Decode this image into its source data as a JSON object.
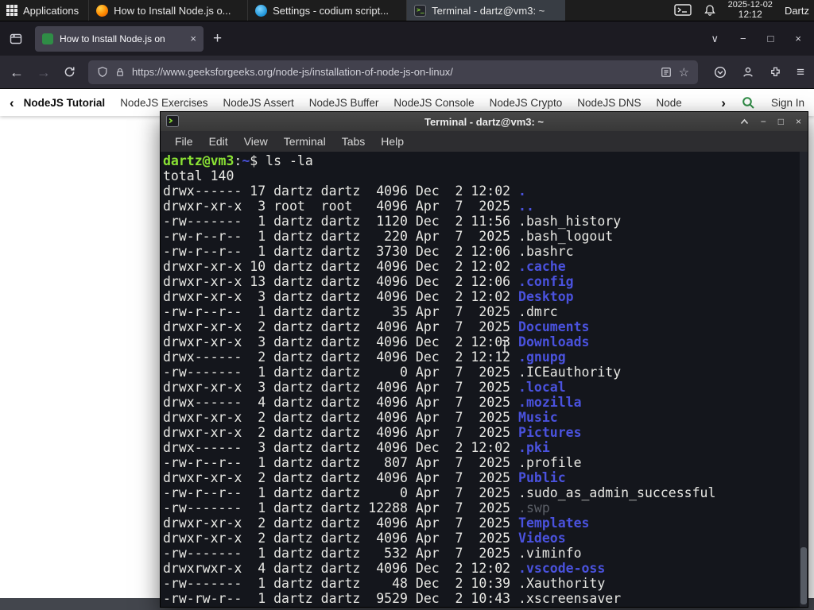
{
  "colors": {
    "accent-green": "#2f8d46",
    "dir-blue": "#4a52de",
    "prompt-green": "#8ae234",
    "dim-gray": "#5c6068"
  },
  "icons": {
    "minimize": "−",
    "maximize": "□",
    "close": "×",
    "chevron_down": "∨",
    "hamburger": "≡",
    "star": "☆",
    "back": "←",
    "forward": "→",
    "new_tab": "+",
    "chevron_left": "‹",
    "chevron_right": "›"
  },
  "panel": {
    "applications_label": "Applications",
    "tasks": [
      {
        "title": "How to Install Node.js o...",
        "icon": "firefox",
        "state": ""
      },
      {
        "title": "Settings - codium script...",
        "icon": "codium",
        "state": ""
      },
      {
        "title": "Terminal - dartz@vm3: ~",
        "icon": "terminal",
        "state": "active"
      }
    ],
    "clock_date": "2025-12-02",
    "clock_time": "12:12",
    "user_label": "Dartz"
  },
  "browser": {
    "tab_title": "How to Install Node.js on",
    "url": "https://www.geeksforgeeks.org/node-js/installation-of-node-js-on-linux/"
  },
  "site_nav": {
    "items": [
      "NodeJS Tutorial",
      "NodeJS Exercises",
      "NodeJS Assert",
      "NodeJS Buffer",
      "NodeJS Console",
      "NodeJS Crypto",
      "NodeJS DNS",
      "Node"
    ],
    "sign_in_label": "Sign In"
  },
  "terminal": {
    "window_title": "Terminal - dartz@vm3: ~",
    "menu_items": [
      "File",
      "Edit",
      "View",
      "Terminal",
      "Tabs",
      "Help"
    ],
    "prompt": {
      "user_host": "dartz@vm3",
      "colon": ":",
      "path": "~",
      "rest": "$ ls -la"
    },
    "total_line": "total 140",
    "lines": [
      {
        "pre": "drwx------ 17 dartz dartz  4096 Dec  2 12:02 ",
        "name": ".",
        "type": "dir"
      },
      {
        "pre": "drwxr-xr-x  3 root  root   4096 Apr  7  2025 ",
        "name": "..",
        "type": "dir"
      },
      {
        "pre": "-rw-------  1 dartz dartz  1120 Dec  2 11:56 ",
        "name": ".bash_history",
        "type": "plain"
      },
      {
        "pre": "-rw-r--r--  1 dartz dartz   220 Apr  7  2025 ",
        "name": ".bash_logout",
        "type": "plain"
      },
      {
        "pre": "-rw-r--r--  1 dartz dartz  3730 Dec  2 12:06 ",
        "name": ".bashrc",
        "type": "plain"
      },
      {
        "pre": "drwxr-xr-x 10 dartz dartz  4096 Dec  2 12:02 ",
        "name": ".cache",
        "type": "dir"
      },
      {
        "pre": "drwxr-xr-x 13 dartz dartz  4096 Dec  2 12:06 ",
        "name": ".config",
        "type": "dir"
      },
      {
        "pre": "drwxr-xr-x  3 dartz dartz  4096 Dec  2 12:02 ",
        "name": "Desktop",
        "type": "dir"
      },
      {
        "pre": "-rw-r--r--  1 dartz dartz    35 Apr  7  2025 ",
        "name": ".dmrc",
        "type": "plain"
      },
      {
        "pre": "drwxr-xr-x  2 dartz dartz  4096 Apr  7  2025 ",
        "name": "Documents",
        "type": "dir"
      },
      {
        "pre": "drwxr-xr-x  3 dartz dartz  4096 Dec  2 12:03 ",
        "name": "Downloads",
        "type": "dir"
      },
      {
        "pre": "drwx------  2 dartz dartz  4096 Dec  2 12:12 ",
        "name": ".gnupg",
        "type": "dir"
      },
      {
        "pre": "-rw-------  1 dartz dartz     0 Apr  7  2025 ",
        "name": ".ICEauthority",
        "type": "plain"
      },
      {
        "pre": "drwxr-xr-x  3 dartz dartz  4096 Apr  7  2025 ",
        "name": ".local",
        "type": "dir"
      },
      {
        "pre": "drwx------  4 dartz dartz  4096 Apr  7  2025 ",
        "name": ".mozilla",
        "type": "dir"
      },
      {
        "pre": "drwxr-xr-x  2 dartz dartz  4096 Apr  7  2025 ",
        "name": "Music",
        "type": "dir"
      },
      {
        "pre": "drwxr-xr-x  2 dartz dartz  4096 Apr  7  2025 ",
        "name": "Pictures",
        "type": "dir"
      },
      {
        "pre": "drwx------  3 dartz dartz  4096 Dec  2 12:02 ",
        "name": ".pki",
        "type": "dir"
      },
      {
        "pre": "-rw-r--r--  1 dartz dartz   807 Apr  7  2025 ",
        "name": ".profile",
        "type": "plain"
      },
      {
        "pre": "drwxr-xr-x  2 dartz dartz  4096 Apr  7  2025 ",
        "name": "Public",
        "type": "dir"
      },
      {
        "pre": "-rw-r--r--  1 dartz dartz     0 Apr  7  2025 ",
        "name": ".sudo_as_admin_successful",
        "type": "plain"
      },
      {
        "pre": "-rw-------  1 dartz dartz 12288 Apr  7  2025 ",
        "name": ".swp",
        "type": "dim"
      },
      {
        "pre": "drwxr-xr-x  2 dartz dartz  4096 Apr  7  2025 ",
        "name": "Templates",
        "type": "dir"
      },
      {
        "pre": "drwxr-xr-x  2 dartz dartz  4096 Apr  7  2025 ",
        "name": "Videos",
        "type": "dir"
      },
      {
        "pre": "-rw-------  1 dartz dartz   532 Apr  7  2025 ",
        "name": ".viminfo",
        "type": "plain"
      },
      {
        "pre": "drwxrwxr-x  4 dartz dartz  4096 Dec  2 12:02 ",
        "name": ".vscode-oss",
        "type": "dir"
      },
      {
        "pre": "-rw-------  1 dartz dartz    48 Dec  2 10:39 ",
        "name": ".Xauthority",
        "type": "plain"
      },
      {
        "pre": "-rw-rw-r--  1 dartz dartz  9529 Dec  2 10:43 ",
        "name": ".xscreensaver",
        "type": "plain"
      }
    ]
  }
}
